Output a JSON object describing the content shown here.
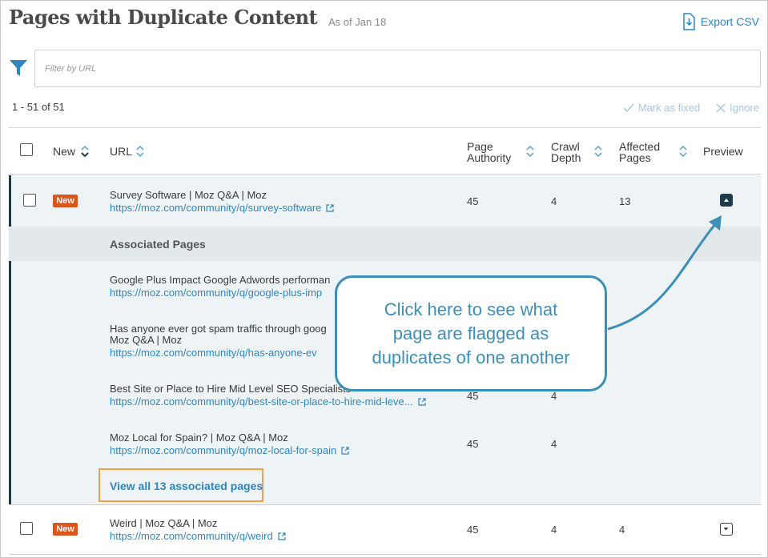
{
  "header": {
    "title": "Pages with Duplicate Content",
    "as_of": "As of Jan 18",
    "export_label": "Export CSV"
  },
  "filter": {
    "placeholder": "Filter by URL"
  },
  "toolbar": {
    "count": "1 - 51 of 51",
    "mark_fixed": "Mark as fixed",
    "ignore": "Ignore"
  },
  "columns": {
    "new": "New",
    "url": "URL",
    "page_authority_1": "Page",
    "page_authority_2": "Authority",
    "crawl_depth_1": "Crawl",
    "crawl_depth_2": "Depth",
    "affected_1": "Affected",
    "affected_2": "Pages",
    "preview": "Preview"
  },
  "rows": [
    {
      "badge": "New",
      "title": "Survey Software | Moz Q&A | Moz",
      "url": "https://moz.com/community/q/survey-software",
      "authority": "45",
      "depth": "4",
      "affected": "13"
    },
    {
      "badge": "New",
      "title": "Weird | Moz Q&A | Moz",
      "url": "https://moz.com/community/q/weird",
      "authority": "45",
      "depth": "4",
      "affected": "4"
    }
  ],
  "associated": {
    "label": "Associated Pages",
    "items": [
      {
        "title": "Google Plus Impact Google Adwords performan",
        "url": "https://moz.com/community/q/google-plus-imp"
      },
      {
        "title": "Has anyone ever got spam traffic through goog",
        "title2": "Moz Q&A | Moz",
        "url": "https://moz.com/community/q/has-anyone-ev"
      },
      {
        "title": "Best Site or Place to Hire Mid Level SEO Specialists",
        "url": "https://moz.com/community/q/best-site-or-place-to-hire-mid-leve...",
        "authority": "45",
        "depth": "4"
      },
      {
        "title": "Moz Local for Spain? | Moz Q&A | Moz",
        "url": "https://moz.com/community/q/moz-local-for-spain",
        "authority": "45",
        "depth": "4"
      }
    ],
    "view_all": "View all 13 associated pages"
  },
  "callout": {
    "text": "Click here to see what\npage are flagged as\nduplicates  of one another"
  },
  "colors": {
    "accent": "#1d3b4a",
    "link": "#2e86c1",
    "badge": "#d9561c",
    "callout": "#3d8fb7",
    "highlight": "#f2a24a"
  }
}
